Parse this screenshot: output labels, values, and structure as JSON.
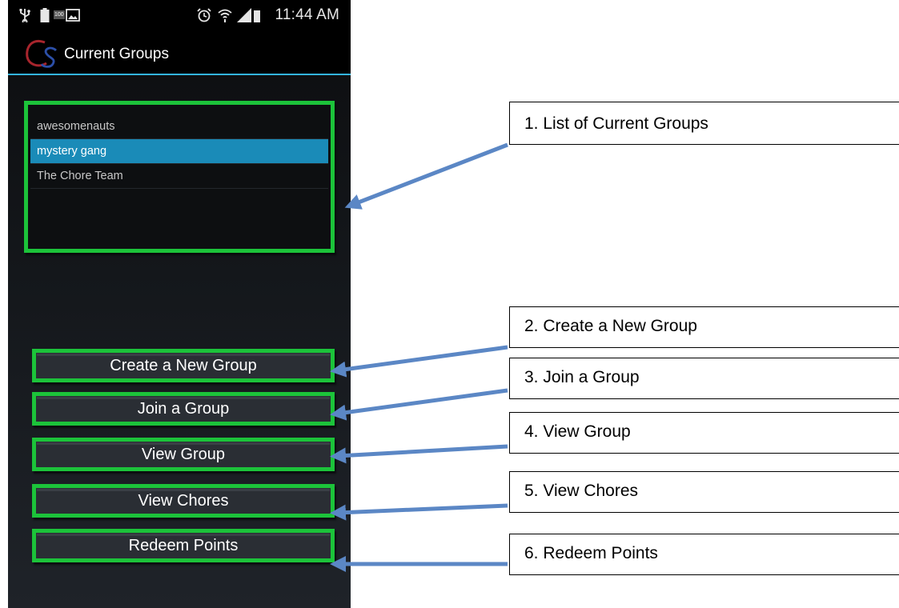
{
  "status_bar": {
    "time": "11:44 AM",
    "battery_badge": "100",
    "icons": [
      "usb-icon",
      "battery-icon",
      "image-icon",
      "alarm-icon",
      "wifi-icon",
      "signal-icon"
    ]
  },
  "action_bar": {
    "logo_icon": "cs-logo-icon",
    "title": "Current Groups"
  },
  "groups": {
    "items": [
      {
        "label": "awesomenauts",
        "selected": false
      },
      {
        "label": "mystery gang",
        "selected": true
      },
      {
        "label": "The Chore Team",
        "selected": false
      }
    ]
  },
  "buttons": {
    "create": "Create a New Group",
    "join": "Join a Group",
    "view_group": "View Group",
    "view_chores": "View Chores",
    "redeem": "Redeem Points"
  },
  "callouts": {
    "list": "1. List of Current Groups",
    "create": "2. Create a New Group",
    "join": "3. Join a Group",
    "view_group": "4. View Group",
    "view_chores": "5. View Chores",
    "redeem": "6. Redeem Points"
  },
  "colors": {
    "highlight_border": "#1cc33a",
    "selected_row": "#1a8bb8",
    "action_underline": "#33b5e5",
    "arrow": "#5b87c5"
  }
}
